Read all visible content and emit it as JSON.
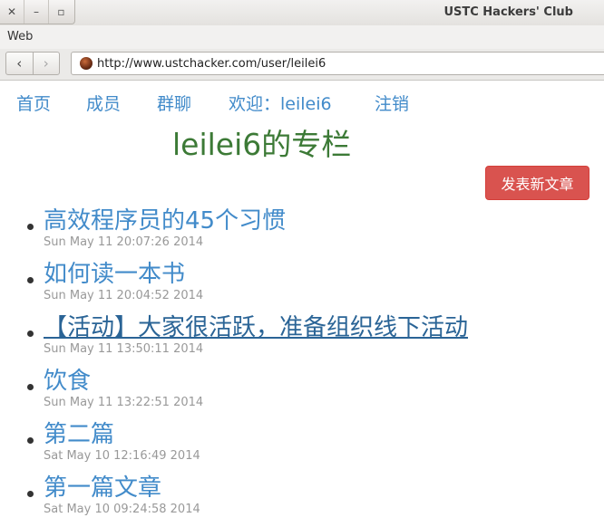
{
  "window": {
    "title": "USTC Hackers' Club",
    "buttons": {
      "close": "✕",
      "minimize": "–",
      "maximize": "▫"
    }
  },
  "menu": {
    "label": "Web"
  },
  "navigation": {
    "back_icon": "‹",
    "forward_icon": "›",
    "url": "http://www.ustchacker.com/user/leilei6"
  },
  "topnav": {
    "home": "首页",
    "members": "成员",
    "group_chat": "群聊",
    "welcome": "欢迎：leilei6",
    "logout": "注销"
  },
  "page": {
    "heading": "leilei6的专栏",
    "new_post_button": "发表新文章"
  },
  "posts": [
    {
      "title": "高效程序员的45个习惯",
      "date": "Sun May 11 20:07:26 2014"
    },
    {
      "title": "如何读一本书",
      "date": "Sun May 11 20:04:52 2014"
    },
    {
      "title": "【活动】大家很活跃，准备组织线下活动",
      "date": "Sun May 11 13:50:11 2014",
      "hovered": true
    },
    {
      "title": "饮食",
      "date": "Sun May 11 13:22:51 2014"
    },
    {
      "title": "第二篇",
      "date": "Sat May 10 12:16:49 2014"
    },
    {
      "title": "第一篇文章",
      "date": "Sat May 10 09:24:58 2014"
    }
  ],
  "colors": {
    "link": "#428bca",
    "link_hover": "#2a6496",
    "heading": "#3c7a36",
    "danger_button": "#d9534f",
    "date_text": "#999999"
  }
}
